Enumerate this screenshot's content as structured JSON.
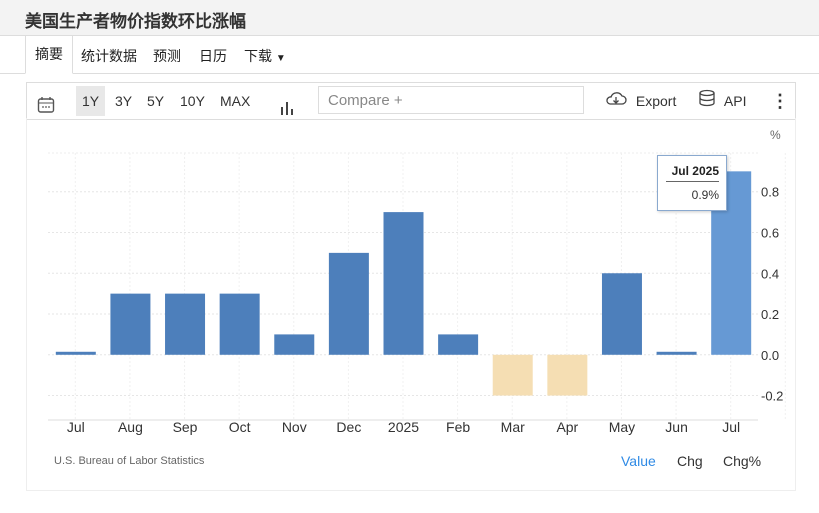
{
  "title": "美国生产者物价指数环比涨幅",
  "tabs": [
    {
      "label": "摘要"
    },
    {
      "label": "统计数据"
    },
    {
      "label": "预测"
    },
    {
      "label": "日历"
    },
    {
      "label": "下载"
    }
  ],
  "toolbar": {
    "ranges": [
      "1Y",
      "3Y",
      "5Y",
      "10Y",
      "MAX"
    ],
    "selected": "1Y",
    "compare_placeholder": "Compare +",
    "export": "Export",
    "api": "API"
  },
  "footer": {
    "source": "U.S. Bureau of Labor Statistics",
    "modes": [
      "Value",
      "Chg",
      "Chg%"
    ],
    "active_mode": "Value"
  },
  "colors": {
    "positive": "#4d7fbb",
    "negative": "#f5deb3",
    "highlight": "#6699d4",
    "link": "#2f8ae5"
  },
  "tooltip": {
    "title": "Jul 2025",
    "value": "0.9%"
  },
  "chart_data": {
    "type": "bar",
    "unit": "%",
    "categories": [
      "Jul",
      "Aug",
      "Sep",
      "Oct",
      "Nov",
      "Dec",
      "2025",
      "Feb",
      "Mar",
      "Apr",
      "May",
      "Jun",
      "Jul"
    ],
    "values": [
      0.0,
      0.3,
      0.3,
      0.3,
      0.1,
      0.5,
      0.7,
      0.1,
      -0.2,
      -0.2,
      0.4,
      0.0,
      0.9
    ],
    "yticks": [
      "0.8",
      "0.6",
      "0.4",
      "0.2",
      "0.0",
      "-0.2"
    ],
    "ytick_values": [
      0.8,
      0.6,
      0.4,
      0.2,
      0.0,
      -0.2
    ],
    "ylim": [
      -0.32,
      0.99
    ],
    "highlight_index": 12,
    "grid": true
  }
}
